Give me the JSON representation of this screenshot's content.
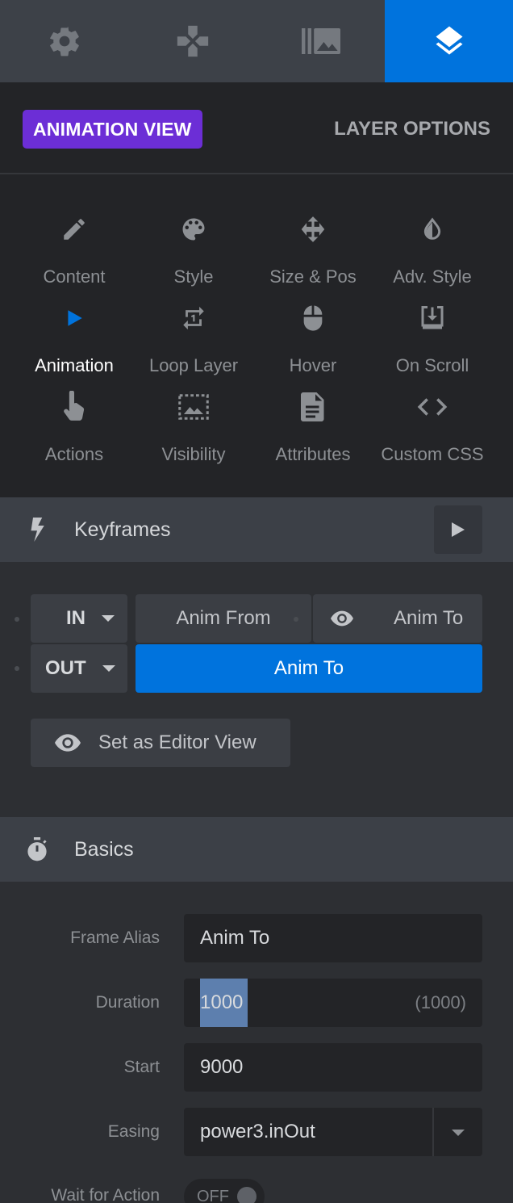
{
  "top_tabs": [
    {
      "icon": "gear-icon",
      "active": false
    },
    {
      "icon": "gamepad-icon",
      "active": false
    },
    {
      "icon": "media-library-icon",
      "active": false
    },
    {
      "icon": "layers-icon",
      "active": true
    }
  ],
  "mode": {
    "animation_view": "ANIMATION VIEW",
    "layer_options": "LAYER OPTIONS"
  },
  "option_grid": [
    {
      "label": "Content",
      "icon": "pencil-icon"
    },
    {
      "label": "Style",
      "icon": "palette-icon"
    },
    {
      "label": "Size & Pos",
      "icon": "move-arrows-icon"
    },
    {
      "label": "Adv. Style",
      "icon": "drop-icon"
    },
    {
      "label": "Animation",
      "icon": "play-icon",
      "active": true
    },
    {
      "label": "Loop Layer",
      "icon": "loop-icon"
    },
    {
      "label": "Hover",
      "icon": "mouse-icon"
    },
    {
      "label": "On Scroll",
      "icon": "scroll-download-icon"
    },
    {
      "label": "Actions",
      "icon": "hand-pointer-icon"
    },
    {
      "label": "Visibility",
      "icon": "visibility-image-icon"
    },
    {
      "label": "Attributes",
      "icon": "document-icon"
    },
    {
      "label": "Custom CSS",
      "icon": "code-icon"
    }
  ],
  "keyframes": {
    "title": "Keyframes",
    "in_label": "IN",
    "out_label": "OUT",
    "anim_from": "Anim From",
    "anim_to_in": "Anim To",
    "anim_to_out": "Anim To",
    "set_editor_view": "Set as Editor View"
  },
  "basics": {
    "title": "Basics",
    "frame_alias_label": "Frame Alias",
    "frame_alias_value": "Anim To",
    "duration_label": "Duration",
    "duration_value": "1000",
    "duration_hint": "(1000)",
    "start_label": "Start",
    "start_value": "9000",
    "easing_label": "Easing",
    "easing_value": "power3.inOut",
    "wait_label": "Wait for Action",
    "wait_value": "OFF"
  },
  "colors": {
    "accent_blue": "#0073dd",
    "accent_purple": "#6c2ed6"
  }
}
